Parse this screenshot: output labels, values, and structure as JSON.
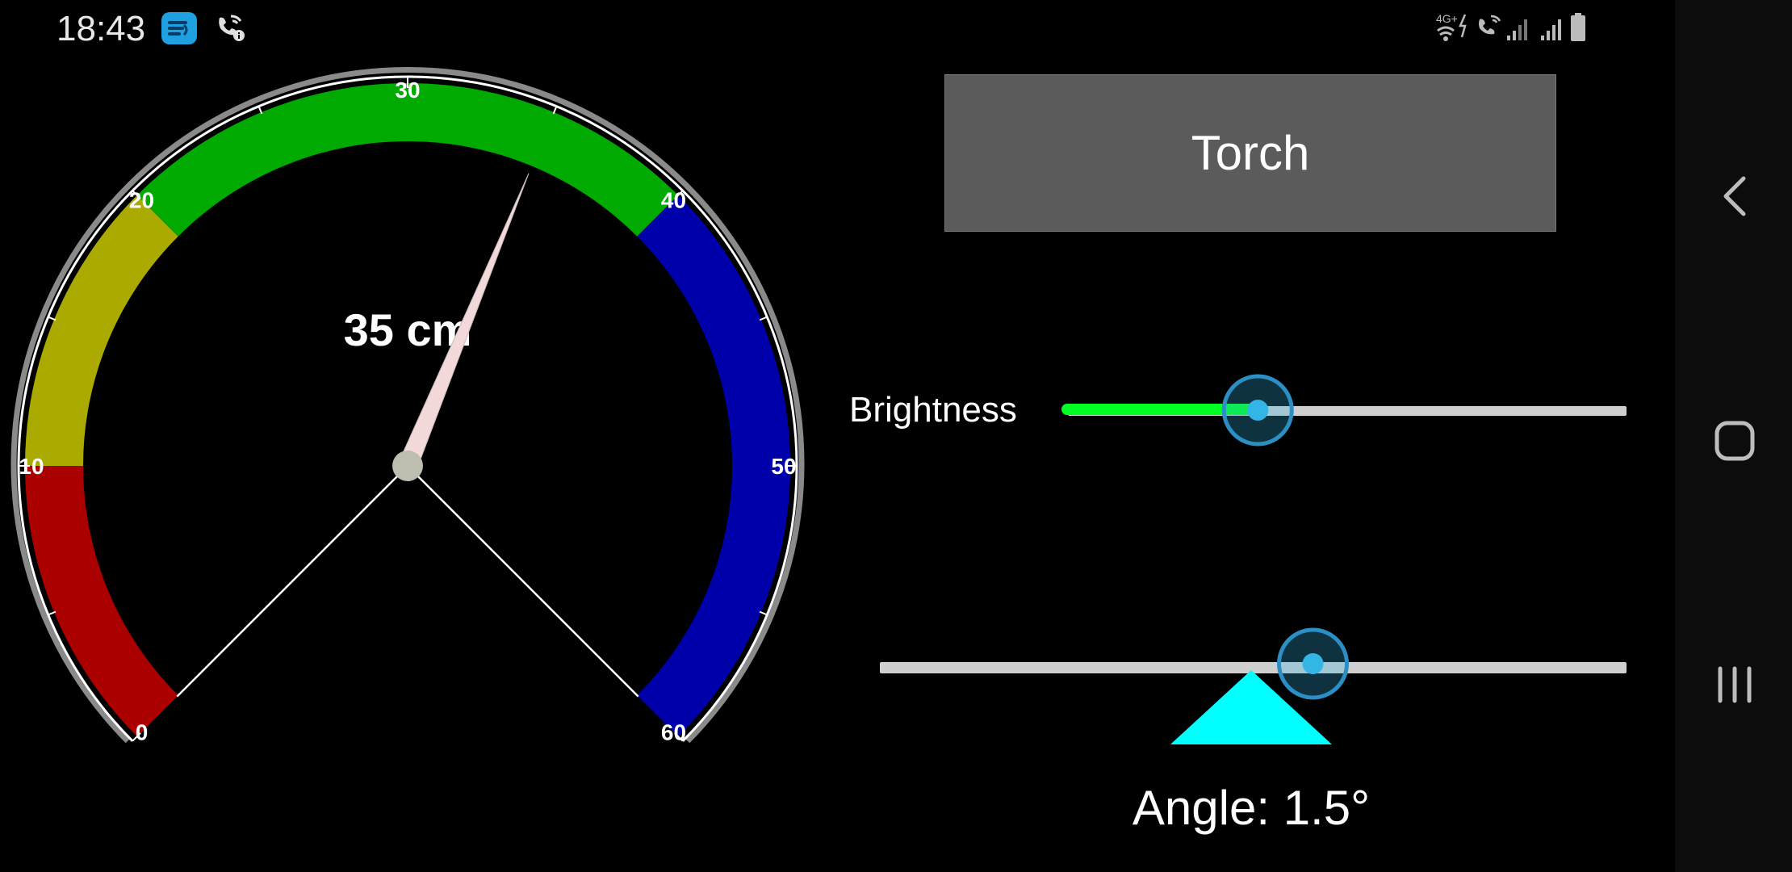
{
  "status_bar": {
    "time": "18:43",
    "network_type": "4G+"
  },
  "gauge": {
    "readout": "35 cm",
    "value": 35,
    "min": 0,
    "max": 60,
    "tick_labels": [
      "0",
      "10",
      "20",
      "30",
      "40",
      "50",
      "60"
    ],
    "bands": [
      {
        "from": 0,
        "to": 10,
        "color": "#aa0000"
      },
      {
        "from": 10,
        "to": 20,
        "color": "#aaaa00"
      },
      {
        "from": 20,
        "to": 40,
        "color": "#00aa00"
      },
      {
        "from": 40,
        "to": 60,
        "color": "#0000aa"
      }
    ]
  },
  "torch": {
    "label": "Torch"
  },
  "brightness": {
    "label": "Brightness",
    "level": 0.34,
    "fill_color": "#00ff22",
    "track_color": "#cfcfcf",
    "thumb_color": "#33b5e5"
  },
  "angle": {
    "label": "Angle: 1.5°",
    "slider_level": 0.58,
    "indicator_color": "#00ffff"
  },
  "nav": {
    "back_icon": "chevron-left-icon",
    "home_icon": "rounded-square-icon",
    "recents_icon": "three-bars-icon"
  }
}
